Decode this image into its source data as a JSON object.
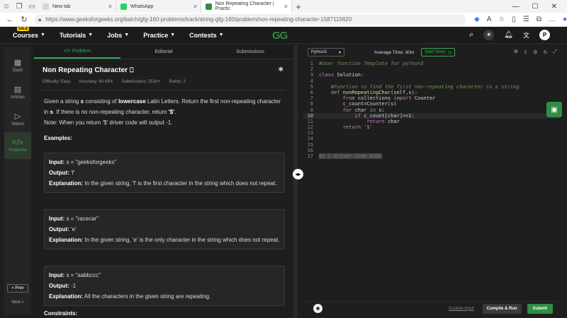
{
  "browser": {
    "tabs": [
      {
        "label": "New tab",
        "favicon_color": "#cfd6e4"
      },
      {
        "label": "WhatsApp",
        "favicon_color": "#25d366"
      },
      {
        "label": "Non Repeating Character | Practic",
        "favicon_color": "#2f8d46"
      }
    ],
    "url": "https://www.geeksforgeeks.org/batch/gfg-160-problems/track/string-gfg-160/problem/non-repeating-character-1587115620"
  },
  "site_nav": {
    "sale_badge": "SALE",
    "items": [
      "Courses",
      "Tutorials",
      "Jobs",
      "Practice",
      "Contests"
    ],
    "logo": "GG",
    "avatar": "P"
  },
  "rail": {
    "items": [
      {
        "label": "Dash",
        "icon": "grid-icon"
      },
      {
        "label": "Articles",
        "icon": "book-icon"
      },
      {
        "label": "Videos",
        "icon": "video-icon"
      },
      {
        "label": "Problems",
        "icon": "code-icon"
      }
    ],
    "prev": "« Prev",
    "next": "Next »"
  },
  "problem": {
    "tabs": [
      "</> Problem",
      "Editorial",
      "Submissions"
    ],
    "title": "Non Repeating Character",
    "difficulty": "Difficulty: Easy",
    "accuracy": "Accuracy: 40.43%",
    "submissions": "Submissions: 251K+",
    "points": "Points: 2",
    "desc_1": "Given a string ",
    "desc_s": "s",
    "desc_2": " consisting of ",
    "desc_lower": "lowercase",
    "desc_3": " Latin Letters. Return the first non-repeating character in ",
    "desc_s2": "s",
    "desc_4": ". If there is no non-repeating character, return ",
    "desc_dollar": "'$'",
    "desc_5": ".",
    "note": "Note: When you return '$' driver code will output -1.",
    "examples_heading": "Examples:",
    "examples": [
      {
        "input": "s = \"geeksforgeeks\"",
        "output": "'f'",
        "explanation": "In the given string, 'f' is the first character in the string which does not repeat."
      },
      {
        "input": "s = \"racecar\"",
        "output": "'e'",
        "explanation": "In the given string, 'e' is the only character in the string which does not repeat."
      },
      {
        "input": "s = \"aabbccc\"",
        "output": "-1",
        "explanation": "All the characters in the given string are repeating."
      }
    ],
    "labels": {
      "input": "Input:",
      "output": "Output:",
      "explanation": "Explanation:"
    },
    "constraints": "Constraints:"
  },
  "editor": {
    "language": "Python3",
    "avg_time": "Average Time: 30m",
    "timer": "Start Timer",
    "line_numbers": [
      "1",
      "2",
      "3",
      "4",
      "5",
      "6",
      "7",
      "8",
      "9",
      "10",
      "11",
      "12",
      "13",
      "14",
      "15",
      "16",
      "17"
    ],
    "code": {
      "l1": "#User function Template for python3",
      "l3a": "class",
      "l3b": " Solution:",
      "l5": "    #Function to find the first non-repeating character in a string.",
      "l6a": "    def ",
      "l6b": "nonRepeatingChar",
      "l6c": "(self,s):",
      "l7a": "        from ",
      "l7b": "collections ",
      "l7c": "import ",
      "l7d": "Counter",
      "l8": "        c_count=Counter(s)",
      "l9a": "        for ",
      "l9b": "char ",
      "l9c": "in ",
      "l9d": "s:",
      "l10a": "            if ",
      "l10b": "c_count[char]==1:",
      "l11a": "                return ",
      "l11b": "char",
      "l12a": "        return ",
      "l12b": "'$'",
      "l17": "#{ } Driver Code Ends"
    },
    "custom_input": "Custom Input",
    "compile_run": "Compile & Run",
    "submit": "Submit"
  }
}
